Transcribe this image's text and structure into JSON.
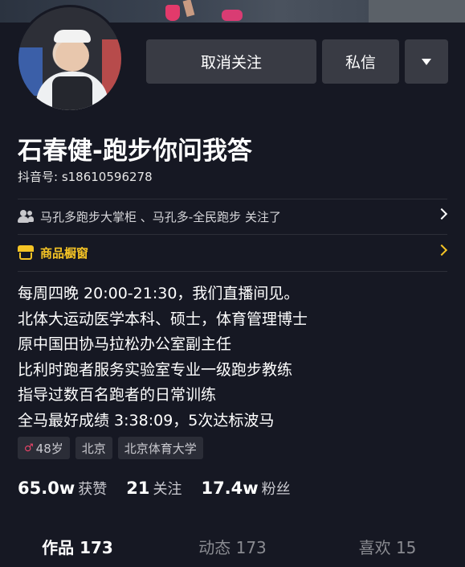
{
  "header": {
    "unfollow_label": "取消关注",
    "message_label": "私信"
  },
  "profile": {
    "name": "石春健-跑步你问我答",
    "douyin_id": "抖音号: s18610596278"
  },
  "follow_info": {
    "text": "马孔多跑步大掌柜 、马孔多-全民跑步 关注了",
    "icon": "people-icon"
  },
  "shop": {
    "label": "商品橱窗",
    "icon": "shop-icon",
    "accent": "#f5c425"
  },
  "bio": [
    "每周四晚 20:00-21:30，我们直播间见。",
    "北体大运动医学本科、硕士，体育管理博士",
    "原中国田协马拉松办公室副主任",
    "比利时跑者服务实验室专业一级跑步教练",
    "指导过数百名跑者的日常训练",
    "全马最好成绩 3:38:09，5次达标波马"
  ],
  "tags": {
    "gender_symbol": "♂",
    "age": "48岁",
    "city": "北京",
    "school": "北京体育大学"
  },
  "stats": {
    "likes_num": "65.0w",
    "likes_label": "获赞",
    "following_num": "21",
    "following_label": "关注",
    "fans_num": "17.4w",
    "fans_label": "粉丝"
  },
  "tabs": {
    "works": "作品 173",
    "moments": "动态 173",
    "likes": "喜欢 15"
  },
  "colors": {
    "background": "#161823",
    "button": "#393b44",
    "gender_icon": "#f0456a"
  }
}
